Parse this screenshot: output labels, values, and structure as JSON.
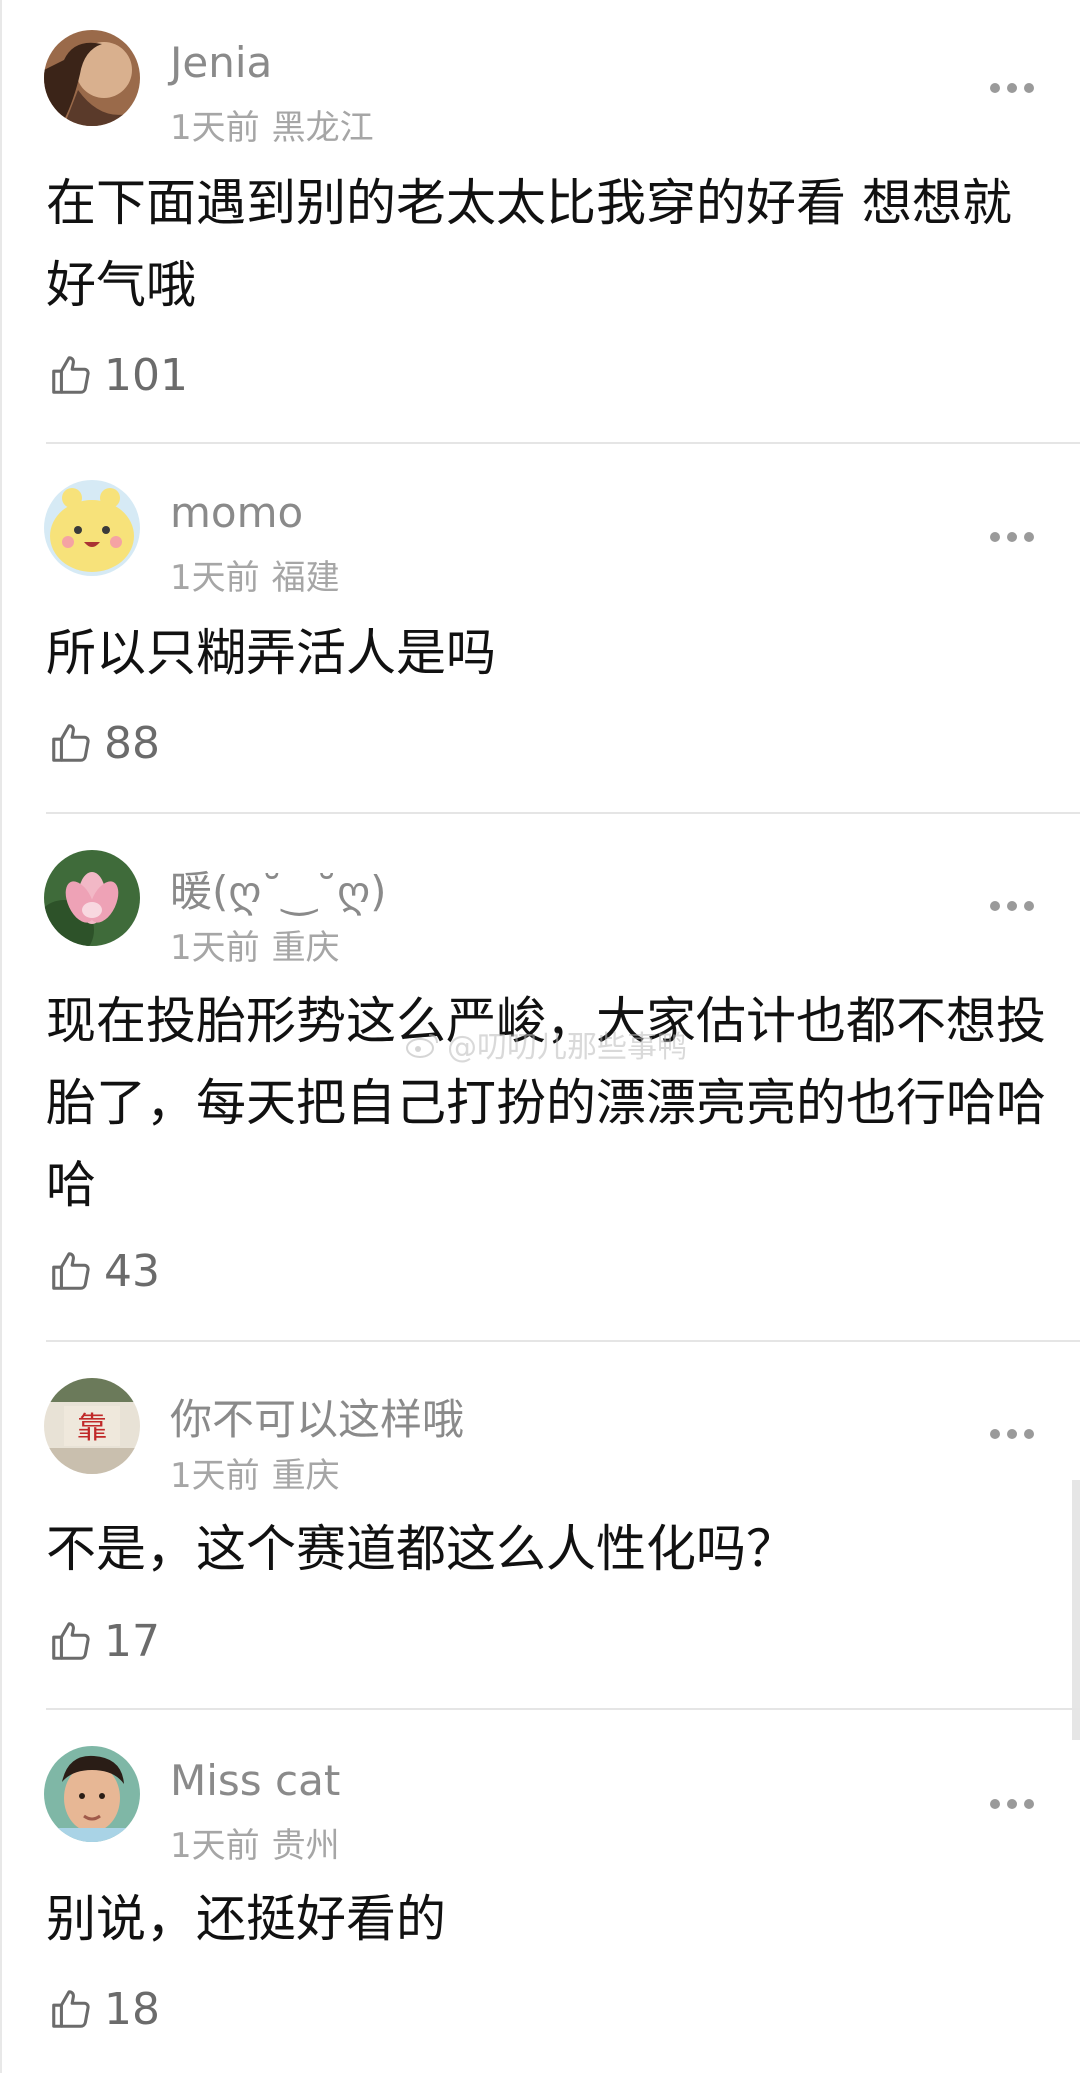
{
  "comments": [
    {
      "username": "Jenia",
      "time": "1天前",
      "location": "黑龙江",
      "text": "在下面遇到别的老太太比我穿的好看 想想就好气哦",
      "likes": "101"
    },
    {
      "username": "momo",
      "time": "1天前",
      "location": "福建",
      "text": "所以只糊弄活人是吗",
      "likes": "88"
    },
    {
      "username": "暖(ღ˘‿˘ღ)",
      "time": "1天前",
      "location": "重庆",
      "text": "现在投胎形势这么严峻，大家估计也都不想投胎了，每天把自己打扮的漂漂亮亮的也行哈哈哈",
      "likes": "43"
    },
    {
      "username": "你不可以这样哦",
      "time": "1天前",
      "location": "重庆",
      "text": "不是，这个赛道都这么人性化吗？",
      "likes": "17"
    },
    {
      "username": "Miss cat",
      "time": "1天前",
      "location": "贵州",
      "text": "别说，还挺好看的",
      "likes": "18"
    }
  ],
  "watermark": "@叨叨儿那些事鸭",
  "icons": {
    "like": "thumbs-up-icon",
    "more": "more-dots-icon",
    "watermark": "weibo-logo-icon"
  },
  "colors": {
    "username": "#8a8a8a",
    "meta": "#a6a6a6",
    "text": "#111111",
    "divider": "#e5e5e5"
  }
}
